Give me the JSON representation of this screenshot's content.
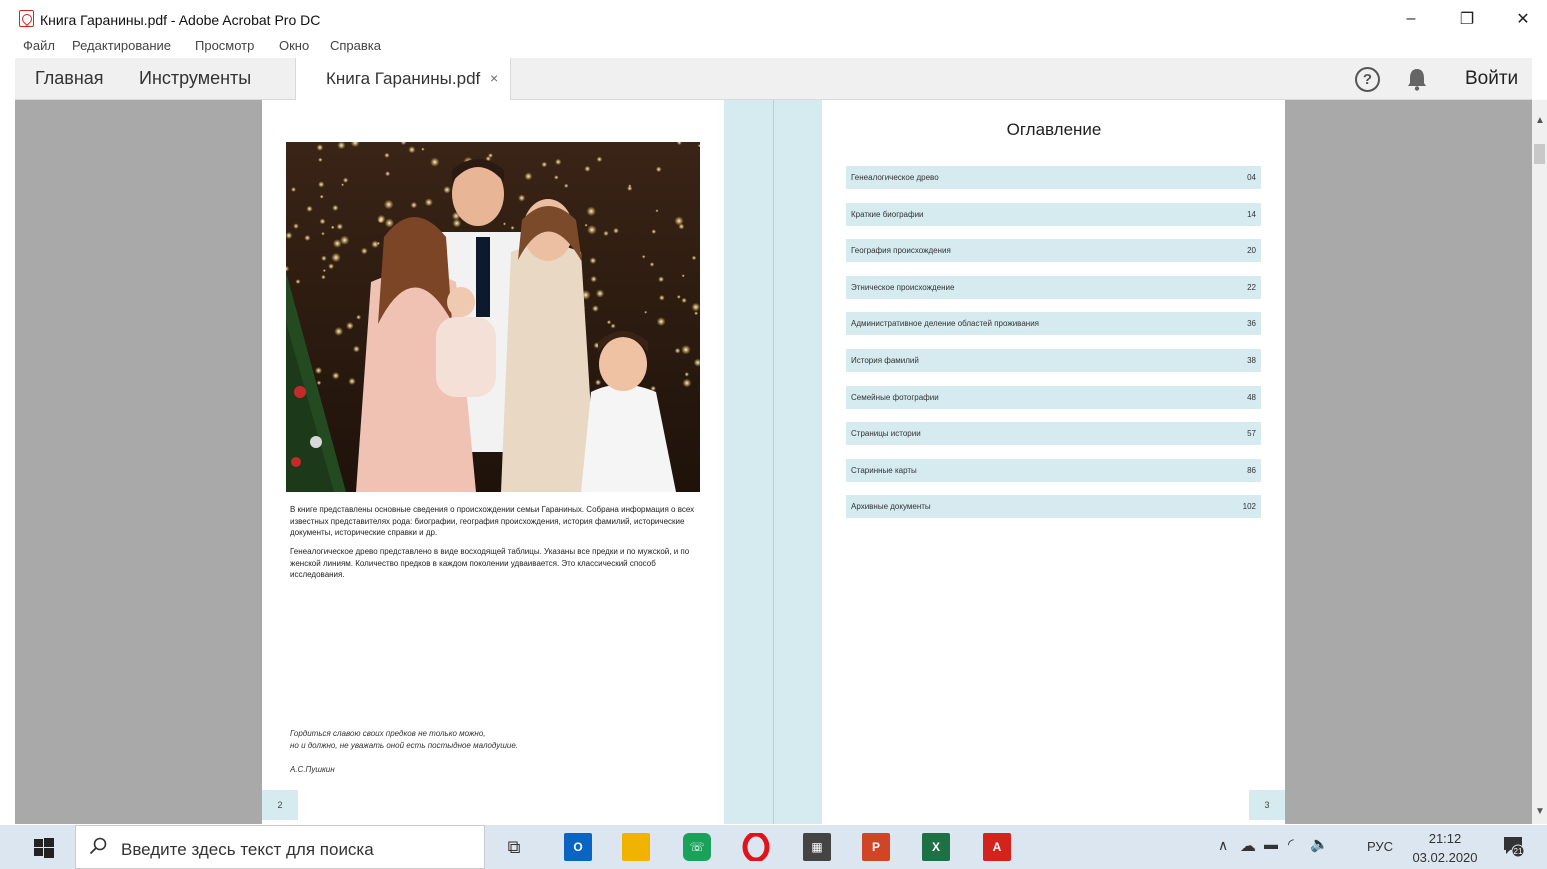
{
  "window": {
    "title": "Книга Гаранины.pdf - Adobe Acrobat Pro DC",
    "controls": [
      "–",
      "❐",
      "✕"
    ]
  },
  "menu": [
    "Файл",
    "Редактирование",
    "Просмотр",
    "Окно",
    "Справка"
  ],
  "tabs": {
    "home": "Главная",
    "tools": "Инструменты",
    "document": "Книга Гаранины.pdf",
    "close": "×",
    "help": "?",
    "signin": "Войти"
  },
  "left_page": {
    "intro_p1": "В книге представлены основные сведения о происхождении семьи Гараниных. Собрана информация о всех известных представителях рода: биографии, география происхождения, история фамилий, исторические документы, исторические справки и др.",
    "intro_p2": "Генеалогическое древо представлено в виде восходящей таблицы. Указаны все предки и по мужской, и по женской линиям. Количество предков в каждом поколении удваивается. Это классический способ исследования.",
    "quote_line1": "Гордиться славою своих предков не только можно,",
    "quote_line2": "но и должно, не уважать оной есть постыдное малодушие.",
    "quote_author": "А.С.Пушкин",
    "page_number": "2"
  },
  "right_page": {
    "toc_title": "Оглавление",
    "toc": [
      {
        "title": "Генеалогическое древо",
        "page": "04"
      },
      {
        "title": "Краткие биографии",
        "page": "14"
      },
      {
        "title": "География происхождения",
        "page": "20"
      },
      {
        "title": "Этническое происхождение",
        "page": "22"
      },
      {
        "title": "Административное деление областей проживания",
        "page": "36"
      },
      {
        "title": "История фамилий",
        "page": "38"
      },
      {
        "title": "Семейные фотографии",
        "page": "48"
      },
      {
        "title": "Страницы истории",
        "page": "57"
      },
      {
        "title": "Старинные карты",
        "page": "86"
      },
      {
        "title": "Архивные документы",
        "page": "102"
      }
    ],
    "page_number": "3"
  },
  "taskbar": {
    "search_placeholder": "Введите здесь текст для поиска",
    "apps": [
      "task-view",
      "outlook",
      "file-explorer",
      "whatsapp",
      "opera",
      "calculator",
      "powerpoint",
      "excel",
      "acrobat"
    ],
    "language": "РУС",
    "time": "21:12",
    "date": "03.02.2020",
    "notifications": "21"
  },
  "colors": {
    "accent_light_blue": "#d5ebf0",
    "acrobat_red": "#d4231c",
    "doc_background": "#a9a9a9",
    "taskbar": "#dbe6f0"
  }
}
